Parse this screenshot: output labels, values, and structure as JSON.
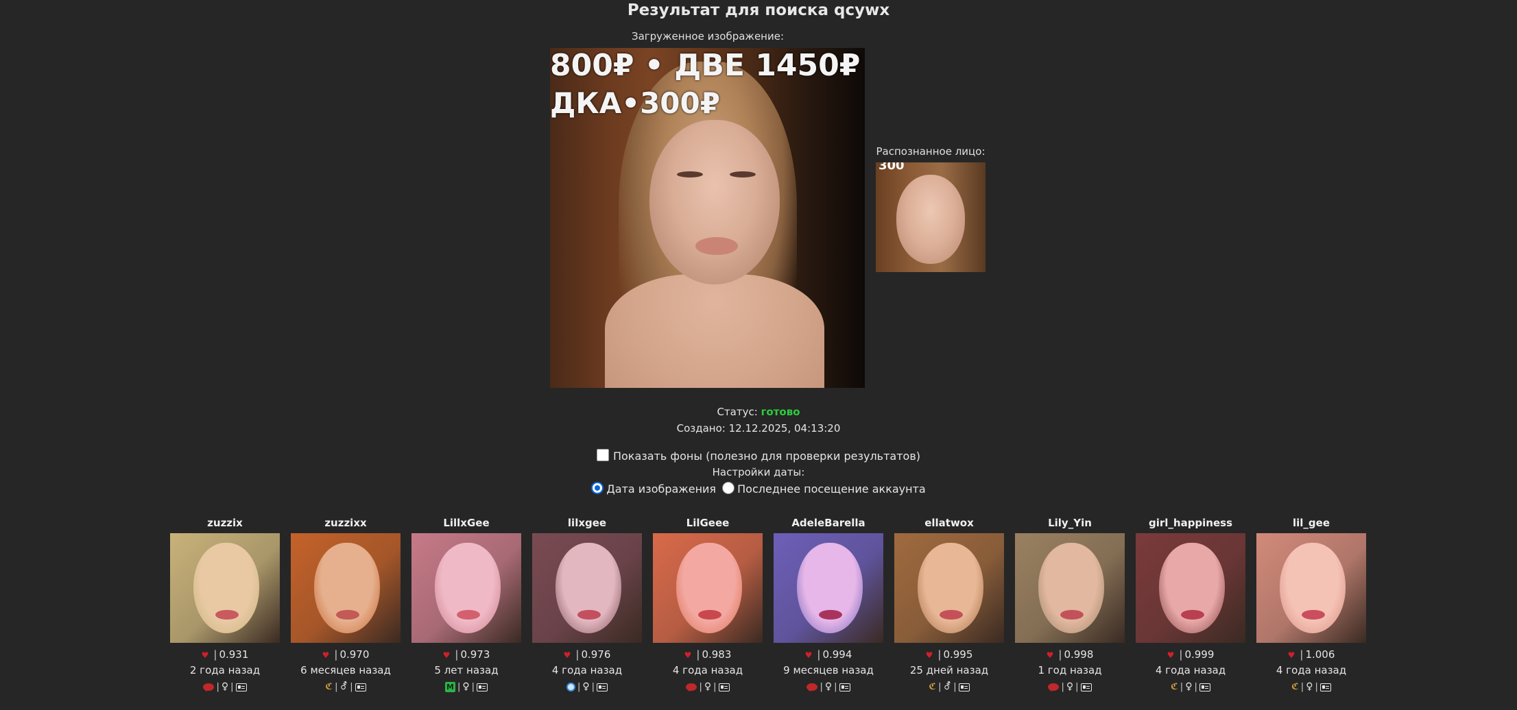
{
  "page_title": "Результат для поиска qcywx",
  "upload": {
    "label": "Загруженное изображение:",
    "overlay_line1": "800₽ • ДВЕ 1450₽",
    "overlay_line2": "ДКА•300₽"
  },
  "face": {
    "label": "Распознанное лицо:",
    "overlay": "300"
  },
  "status": {
    "label": "Статус:",
    "value": "готово",
    "value_color": "#2ecc40"
  },
  "created": "Создано: 12.12.2025, 04:13:20",
  "show_backgrounds": {
    "label": "Показать фоны (полезно для проверки результатов)",
    "checked": false
  },
  "date_settings": {
    "label": "Настройки даты:",
    "options": [
      {
        "label": "Дата изображения",
        "selected": true
      },
      {
        "label": "Последнее посещение аккаунта",
        "selected": false
      }
    ]
  },
  "results": [
    {
      "username": "zuzzix",
      "score": "0.931",
      "ago": "2 года назад",
      "icons": [
        "chat-icon",
        "female-icon",
        "profile-card-icon"
      ],
      "icon_text": [
        "",
        "♀",
        ""
      ]
    },
    {
      "username": "zuzzixx",
      "score": "0.970",
      "ago": "6 месяцев назад",
      "icons": [
        "horn-icon",
        "mixed-gender-icon",
        "profile-card-icon"
      ],
      "icon_text": [
        "ℭ",
        "⚦",
        ""
      ]
    },
    {
      "username": "LillxGee",
      "score": "0.973",
      "ago": "5 лет назад",
      "icons": [
        "m-badge-icon",
        "female-icon",
        "profile-card-icon"
      ],
      "icon_text": [
        "M",
        "♀",
        ""
      ]
    },
    {
      "username": "lilxgee",
      "score": "0.976",
      "ago": "4 года назад",
      "icons": [
        "circle-badge-icon",
        "female-icon",
        "profile-card-icon"
      ],
      "icon_text": [
        "",
        "♀",
        ""
      ]
    },
    {
      "username": "LilGeee",
      "score": "0.983",
      "ago": "4 года назад",
      "icons": [
        "chat-icon",
        "female-icon",
        "profile-card-icon"
      ],
      "icon_text": [
        "",
        "♀",
        ""
      ]
    },
    {
      "username": "AdeleBarella",
      "score": "0.994",
      "ago": "9 месяцев назад",
      "icons": [
        "chat-icon",
        "female-icon",
        "profile-card-icon"
      ],
      "icon_text": [
        "",
        "♀",
        ""
      ]
    },
    {
      "username": "ellatwox",
      "score": "0.995",
      "ago": "25 дней назад",
      "icons": [
        "horn-icon",
        "mixed-gender-icon",
        "profile-card-icon"
      ],
      "icon_text": [
        "ℭ",
        "⚦",
        ""
      ]
    },
    {
      "username": "Lily_Yin",
      "score": "0.998",
      "ago": "1 год назад",
      "icons": [
        "chat-icon",
        "female-icon",
        "profile-card-icon"
      ],
      "icon_text": [
        "",
        "♀",
        ""
      ]
    },
    {
      "username": "girl_happiness",
      "score": "0.999",
      "ago": "4 года назад",
      "icons": [
        "horn-icon",
        "female-icon",
        "profile-card-icon"
      ],
      "icon_text": [
        "ℭ",
        "♀",
        ""
      ]
    },
    {
      "username": "lil_gee",
      "score": "1.006",
      "ago": "4 года назад",
      "icons": [
        "horn-icon",
        "female-icon",
        "profile-card-icon"
      ],
      "icon_text": [
        "ℭ",
        "♀",
        ""
      ]
    }
  ]
}
